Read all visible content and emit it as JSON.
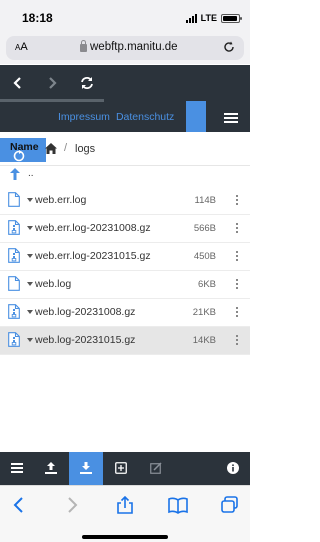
{
  "status_bar": {
    "time": "18:18",
    "network": "LTE",
    "battery_level": 0.9
  },
  "browser": {
    "text_size_label": "A",
    "text_size_label_large": "A",
    "url": "webftp.manitu.de"
  },
  "app_header": {
    "links": [
      "Impressum",
      "Datenschutz"
    ]
  },
  "breadcrumb": {
    "column_label": "Name",
    "current_folder": "logs",
    "separator": "/"
  },
  "parent_dir_label": "..",
  "files": [
    {
      "name": "web.err.log",
      "size": "114B",
      "type": "text"
    },
    {
      "name": "web.err.log-20231008.gz",
      "size": "566B",
      "type": "archive"
    },
    {
      "name": "web.err.log-20231015.gz",
      "size": "450B",
      "type": "archive"
    },
    {
      "name": "web.log",
      "size": "6KB",
      "type": "text"
    },
    {
      "name": "web.log-20231008.gz",
      "size": "21KB",
      "type": "archive"
    },
    {
      "name": "web.log-20231015.gz",
      "size": "14KB",
      "type": "archive",
      "selected": true
    }
  ],
  "colors": {
    "accent": "#4a90e2",
    "dark": "#2b333b",
    "selected_row": "#e6e6e6"
  }
}
